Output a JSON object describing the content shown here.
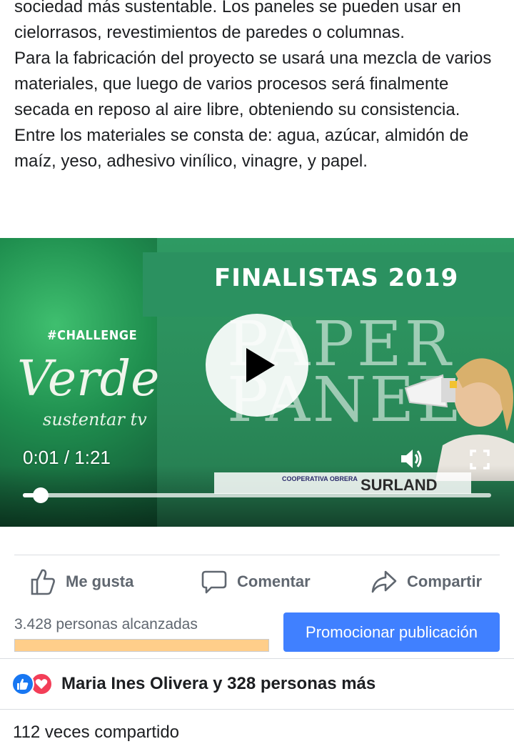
{
  "post": {
    "paragraphs": [
      "sociedad más sustentable. Los paneles se pueden usar en cielorrasos, revestimientos de paredes o columnas.",
      "Para la fabricación del proyecto se usará una mezcla de varios materiales, que luego de varios procesos será finalmente secada en reposo al aire libre, obteniendo su consistencia. Entre los materiales se consta de: agua, azúcar, almidón de maíz, yeso, adhesivo vinílico, vinagre, y papel."
    ]
  },
  "video": {
    "headline": "FINALISTAS 2019",
    "challenge_tag": "#CHALLENGE",
    "brand_main": "Verde",
    "brand_sub": "sustentar tv",
    "project_title_line1": "PAPER",
    "project_title_line2": "PANELS",
    "sponsor_a": "COOPERATIVA OBRERA",
    "sponsor_b": "SURLAND",
    "time_display": "0:01 / 1:21",
    "progress_fraction": 0.012
  },
  "actions": {
    "like_label": "Me gusta",
    "comment_label": "Comentar",
    "share_label": "Compartir"
  },
  "insights": {
    "reach_text": "3.428 personas alcanzadas",
    "reach_fraction": 1.0,
    "promote_label": "Promocionar publicación"
  },
  "reactions": {
    "summary": "Maria Ines Olivera y 328 personas más"
  },
  "shares": {
    "text": "112 veces compartido"
  },
  "colors": {
    "brand_blue": "#4080ff",
    "like_blue": "#1877f2",
    "love_red": "#f33e58",
    "reach_bar": "#ffce8a",
    "video_green": "#2e9a63"
  }
}
